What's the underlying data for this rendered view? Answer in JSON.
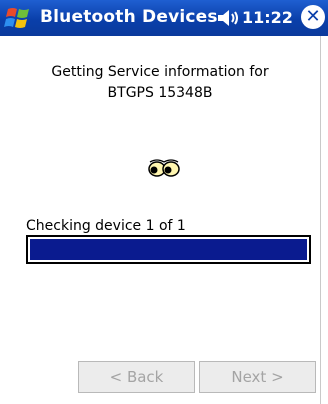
{
  "titlebar": {
    "title": "Bluetooth Devices",
    "time": "11:22",
    "start_icon": "windows-flag-icon",
    "volume_icon": "speaker-icon",
    "close_label": "✕"
  },
  "main": {
    "info_line1": "Getting Service information for",
    "info_line2": "BTGPS 15348B",
    "eyes_icon": "eyes-icon",
    "checking_text": "Checking device 1 of 1",
    "progress_fraction": 1.0,
    "progress_color": "#0a1b8f"
  },
  "buttons": {
    "back_label": "< Back",
    "next_label": "Next >"
  }
}
